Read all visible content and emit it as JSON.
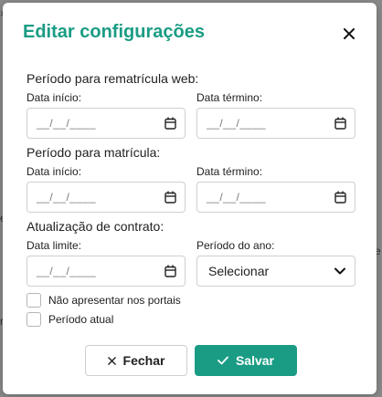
{
  "modal": {
    "title": "Editar configurações"
  },
  "rematricula": {
    "section_title": "Período para rematrícula web:",
    "start_label": "Data início:",
    "end_label": "Data término:",
    "start_placeholder": "__/__/____",
    "end_placeholder": "__/__/____"
  },
  "matricula": {
    "section_title": "Período para matrícula:",
    "start_label": "Data início:",
    "end_label": "Data término:",
    "start_placeholder": "__/__/____",
    "end_placeholder": "__/__/____"
  },
  "contrato": {
    "section_title": "Atualização de contrato:",
    "limit_label": "Data limite:",
    "limit_placeholder": "__/__/____",
    "period_label": "Período do ano:",
    "period_selected": "Selecionar"
  },
  "options": {
    "hide_in_portals_label": "Não apresentar nos portais",
    "current_period_label": "Período atual"
  },
  "footer": {
    "close_label": "Fechar",
    "save_label": "Salvar"
  },
  "colors": {
    "accent": "#1a9c84",
    "overlay": "#8a8a8a"
  }
}
